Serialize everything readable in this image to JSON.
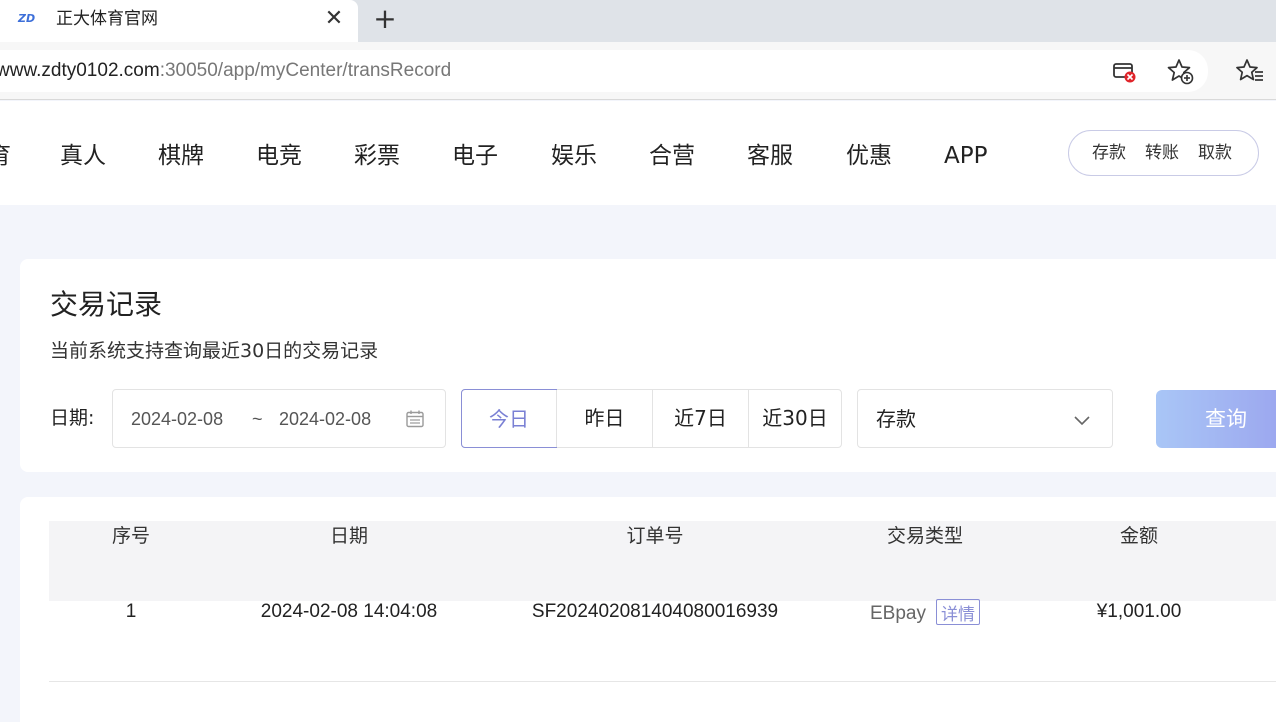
{
  "browser": {
    "tab_title": "正大体育官网",
    "favicon_text": "ZD",
    "url_host": "www.zdty0102.com",
    "url_path": ":30050/app/myCenter/transRecord",
    "tab_close_glyph": "✕",
    "new_tab_glyph": "+"
  },
  "nav": {
    "items": [
      "育",
      "真人",
      "棋牌",
      "电竞",
      "彩票",
      "电子",
      "娱乐",
      "合营",
      "客服",
      "优惠",
      "APP"
    ],
    "actions": [
      "存款",
      "转账",
      "取款"
    ]
  },
  "page": {
    "title": "交易记录",
    "subtitle": "当前系统支持查询最近30日的交易记录"
  },
  "filters": {
    "date_label": "日期:",
    "start_date": "2024-02-08",
    "separator": "~",
    "end_date": "2024-02-08",
    "quick_ranges": [
      "今日",
      "昨日",
      "近7日",
      "近30日"
    ],
    "active_range": "今日",
    "type_selected": "存款",
    "query_label": "查询"
  },
  "table": {
    "headers": [
      "序号",
      "日期",
      "订单号",
      "交易类型",
      "金额"
    ],
    "rows": [
      {
        "index": "1",
        "date": "2024-02-08 14:04:08",
        "order_no": "SF20240208140408001 6939",
        "type": "EBpay",
        "detail_label": "详情",
        "amount": "¥1,001.00"
      }
    ]
  },
  "colors": {
    "accent": "#8a8fd6",
    "query_gradient_start": "#a9c6f6",
    "query_gradient_end": "#9aa3ee",
    "page_bg": "#f3f5fb"
  },
  "icons": {
    "tab_favicon": "zd-logo-icon",
    "tab_close": "close-icon",
    "new_tab": "plus-icon",
    "tracking_blocked": "tracking-blocked-icon",
    "add_favorite": "star-plus-icon",
    "favorites": "favorites-list-icon",
    "calendar": "calendar-icon",
    "dropdown": "chevron-down-icon"
  }
}
